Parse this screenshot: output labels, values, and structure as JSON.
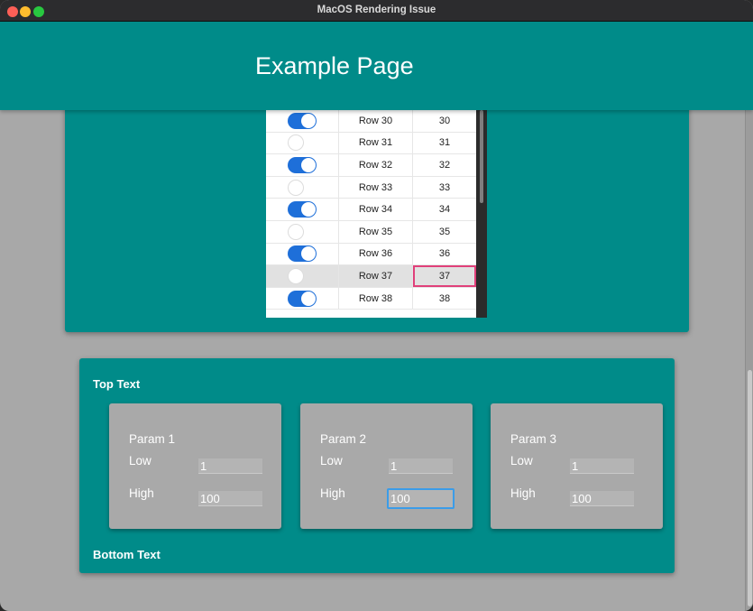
{
  "window": {
    "title": "MacOS Rendering Issue"
  },
  "header": {
    "title": "Example Page"
  },
  "table": {
    "rows": [
      {
        "toggle": "on",
        "name": "Row 30",
        "value": "30",
        "selected": false
      },
      {
        "toggle": "off",
        "name": "Row 31",
        "value": "31",
        "selected": false
      },
      {
        "toggle": "on",
        "name": "Row 32",
        "value": "32",
        "selected": false
      },
      {
        "toggle": "off",
        "name": "Row 33",
        "value": "33",
        "selected": false
      },
      {
        "toggle": "on",
        "name": "Row 34",
        "value": "34",
        "selected": false
      },
      {
        "toggle": "off",
        "name": "Row 35",
        "value": "35",
        "selected": false
      },
      {
        "toggle": "on",
        "name": "Row 36",
        "value": "36",
        "selected": false
      },
      {
        "toggle": "off",
        "name": "Row 37",
        "value": "37",
        "selected": true
      },
      {
        "toggle": "on",
        "name": "Row 38",
        "value": "38",
        "selected": false
      }
    ]
  },
  "section": {
    "top_text": "Top Text",
    "bottom_text": "Bottom Text",
    "params": [
      {
        "title": "Param 1",
        "low_label": "Low",
        "low_value": "1",
        "high_label": "High",
        "high_value": "100"
      },
      {
        "title": "Param 2",
        "low_label": "Low",
        "low_value": "1",
        "high_label": "High",
        "high_value": "100"
      },
      {
        "title": "Param 3",
        "low_label": "Low",
        "low_value": "1",
        "high_label": "High",
        "high_value": "100"
      }
    ]
  },
  "colors": {
    "teal": "#008b89",
    "toggle_blue": "#1e6fd9",
    "focus_pink": "#e0407a",
    "focus_blue": "#3b9ce8"
  }
}
